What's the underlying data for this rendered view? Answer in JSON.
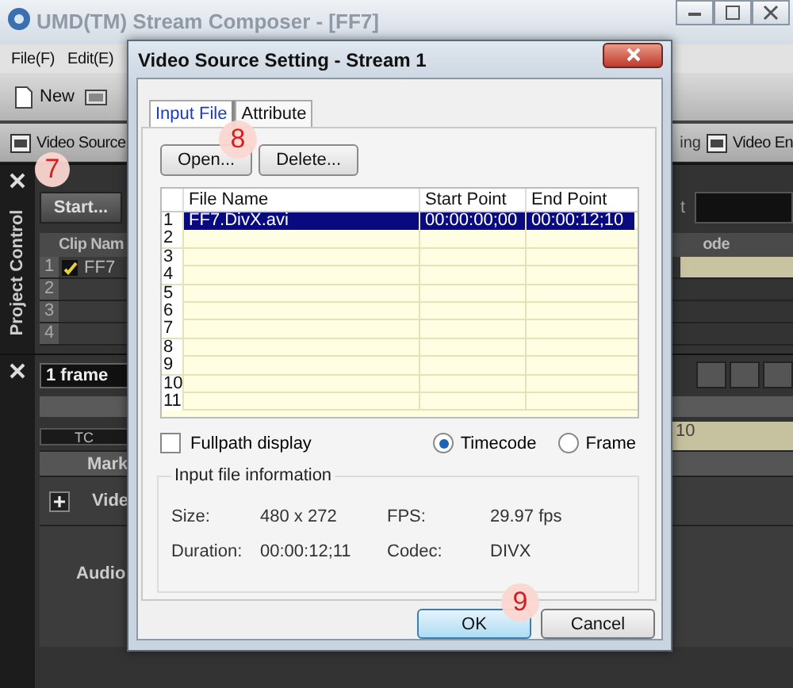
{
  "app": {
    "title": "UMD(TM) Stream Composer - [FF7]",
    "menu": [
      {
        "label": "File(F)"
      },
      {
        "label": "Edit(E)"
      }
    ],
    "toolbar": [
      {
        "label": "New"
      }
    ],
    "view_bar": {
      "left": "Video Source",
      "right_partial": "ing",
      "right": "Video En"
    },
    "project_panel": {
      "title": "Project Control",
      "start_button": "Start...",
      "field_label": "t",
      "columns": [
        "Clip Nam",
        "ode"
      ],
      "rows": [
        {
          "number": "1",
          "checked": true,
          "clip": "FF7",
          "selected": true
        },
        {
          "number": "2",
          "checked": false,
          "selected": false
        },
        {
          "number": "3",
          "checked": false,
          "selected": false
        },
        {
          "number": "4",
          "checked": false,
          "selected": false
        }
      ]
    },
    "timeline": {
      "scale": "1 frame",
      "tc_button": "TC",
      "ruler_label": "10",
      "tracks": [
        {
          "label": "Mark",
          "kind": "header"
        },
        {
          "label": "Vide",
          "kind": "expandable"
        },
        {
          "label": "Audio",
          "kind": "plain"
        }
      ]
    }
  },
  "dialog": {
    "title": "Video Source Setting - Stream 1",
    "tabs": [
      {
        "label": "Input File",
        "selected": true
      },
      {
        "label": "Attribute",
        "selected": false
      }
    ],
    "buttons": [
      {
        "label": "Open..."
      },
      {
        "label": "Delete..."
      }
    ],
    "table": {
      "columns": [
        "File Name",
        "Start Point",
        "End Point"
      ],
      "rows": [
        {
          "number": "1",
          "file_name": "FF7.DivX.avi",
          "start_point": "00:00:00;00",
          "end_point": "00:00:12;10",
          "selected": true
        },
        {
          "number": "2",
          "selected": false
        },
        {
          "number": "3",
          "selected": false
        },
        {
          "number": "4",
          "selected": false
        },
        {
          "number": "5",
          "selected": false
        },
        {
          "number": "6",
          "selected": false
        },
        {
          "number": "7",
          "selected": false
        },
        {
          "number": "8",
          "selected": false
        },
        {
          "number": "9",
          "selected": false
        },
        {
          "number": "10",
          "selected": false
        },
        {
          "number": "11",
          "selected": false
        }
      ]
    },
    "fullpath_display": {
      "label": "Fullpath display",
      "checked": false
    },
    "display_mode": [
      {
        "label": "Timecode",
        "selected": true
      },
      {
        "label": "Frame",
        "selected": false
      }
    ],
    "info": {
      "title": "Input file information",
      "fields": [
        {
          "label": "Size:",
          "value": "480 x 272"
        },
        {
          "label": "FPS:",
          "value": "29.97 fps"
        },
        {
          "label": "Duration:",
          "value": "00:00:12;11"
        },
        {
          "label": "Codec:",
          "value": "DIVX"
        }
      ]
    },
    "footer_buttons": [
      {
        "label": "OK",
        "default": true
      },
      {
        "label": "Cancel",
        "default": false
      }
    ]
  },
  "step_markers": [
    {
      "label": "7"
    },
    {
      "label": "8"
    },
    {
      "label": "9"
    }
  ]
}
